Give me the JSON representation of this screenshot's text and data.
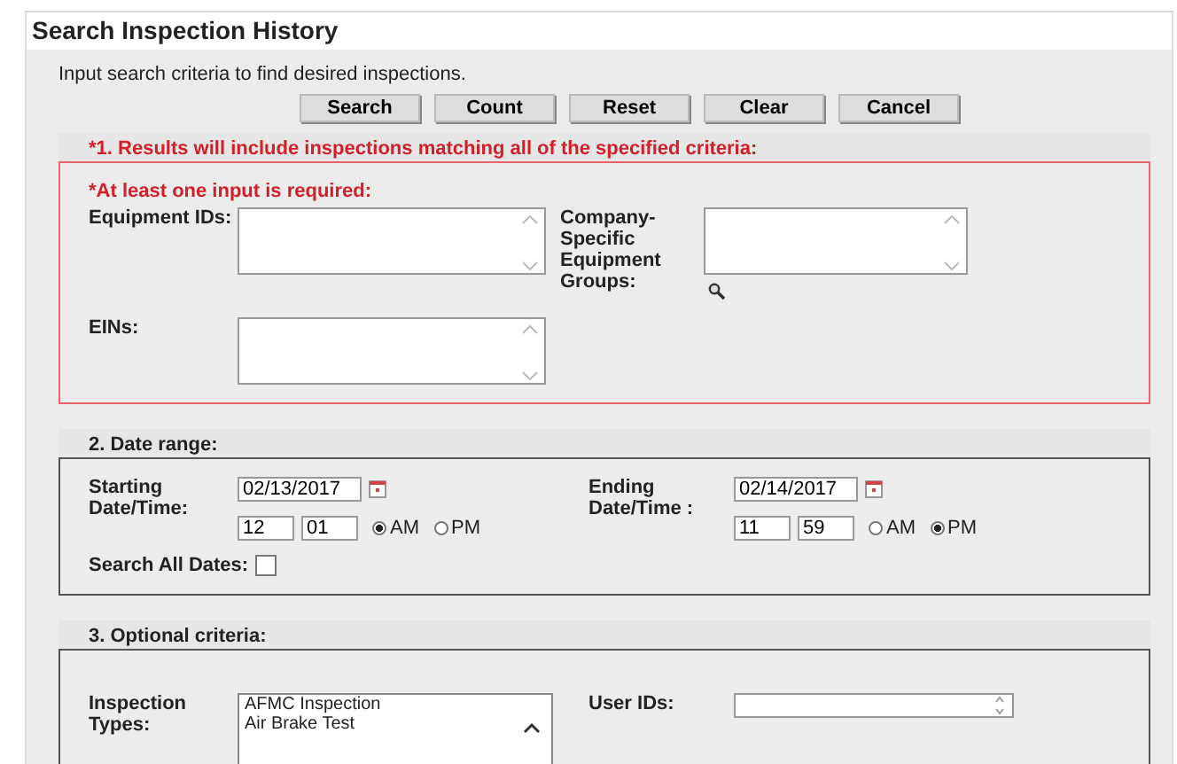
{
  "title": "Search Inspection History",
  "instructions": "Input search criteria to find desired inspections.",
  "buttons": [
    "Search",
    "Count",
    "Reset",
    "Clear",
    "Cancel"
  ],
  "section1": {
    "header": "*1. Results will include inspections matching all of the specified criteria:",
    "required_note": "*At least one input is required:",
    "fields": [
      {
        "label": "Equipment IDs:"
      },
      {
        "label": "Company-Specific Equipment Groups:"
      },
      {
        "label": "EINs:"
      }
    ]
  },
  "section2": {
    "header": "2. Date range:",
    "ranges": [
      {
        "label": "Starting Date/Time:",
        "date": "02/13/2017",
        "hour": "12",
        "minute": "01",
        "options": [
          {
            "label": "AM",
            "selected": true
          },
          {
            "label": "PM",
            "selected": false
          }
        ]
      },
      {
        "label": "Ending Date/Time :",
        "date": "02/14/2017",
        "hour": "11",
        "minute": "59",
        "options": [
          {
            "label": "AM",
            "selected": false
          },
          {
            "label": "PM",
            "selected": true
          }
        ]
      }
    ],
    "search_all": {
      "label": "Search All Dates:",
      "checked": false
    }
  },
  "section3": {
    "header": "3. Optional criteria:",
    "inspection_types": {
      "label": "Inspection Types:",
      "items": [
        "AFMC Inspection",
        "Air Brake Test"
      ]
    },
    "user_ids": {
      "label": "User IDs:"
    }
  }
}
